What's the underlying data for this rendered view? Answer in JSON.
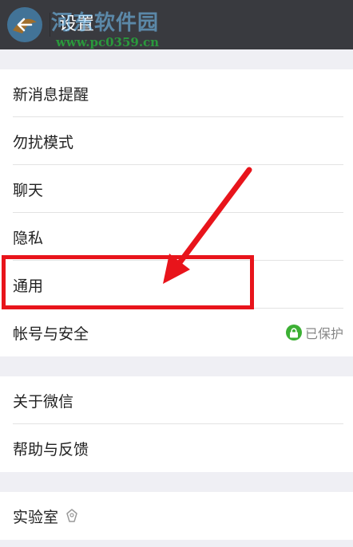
{
  "header": {
    "title": "设置",
    "watermark_name": "河东软件园",
    "watermark_url": "www.pc0359.cn"
  },
  "groups": [
    {
      "items": [
        {
          "label": "新消息提醒"
        },
        {
          "label": "勿扰模式"
        },
        {
          "label": "聊天"
        },
        {
          "label": "隐私"
        },
        {
          "label": "通用"
        },
        {
          "label": "帐号与安全",
          "status": "已保护"
        }
      ]
    },
    {
      "items": [
        {
          "label": "关于微信"
        },
        {
          "label": "帮助与反馈"
        }
      ]
    },
    {
      "items": [
        {
          "label": "实验室"
        }
      ]
    }
  ],
  "colors": {
    "topbar": "#393a3f",
    "background": "#efeff4",
    "protect_badge": "#3cb034",
    "annotation": "#e8141b"
  },
  "icons": {
    "back": "arrow-left-icon",
    "lock": "lock-icon",
    "lab": "lab-bulb-icon"
  }
}
